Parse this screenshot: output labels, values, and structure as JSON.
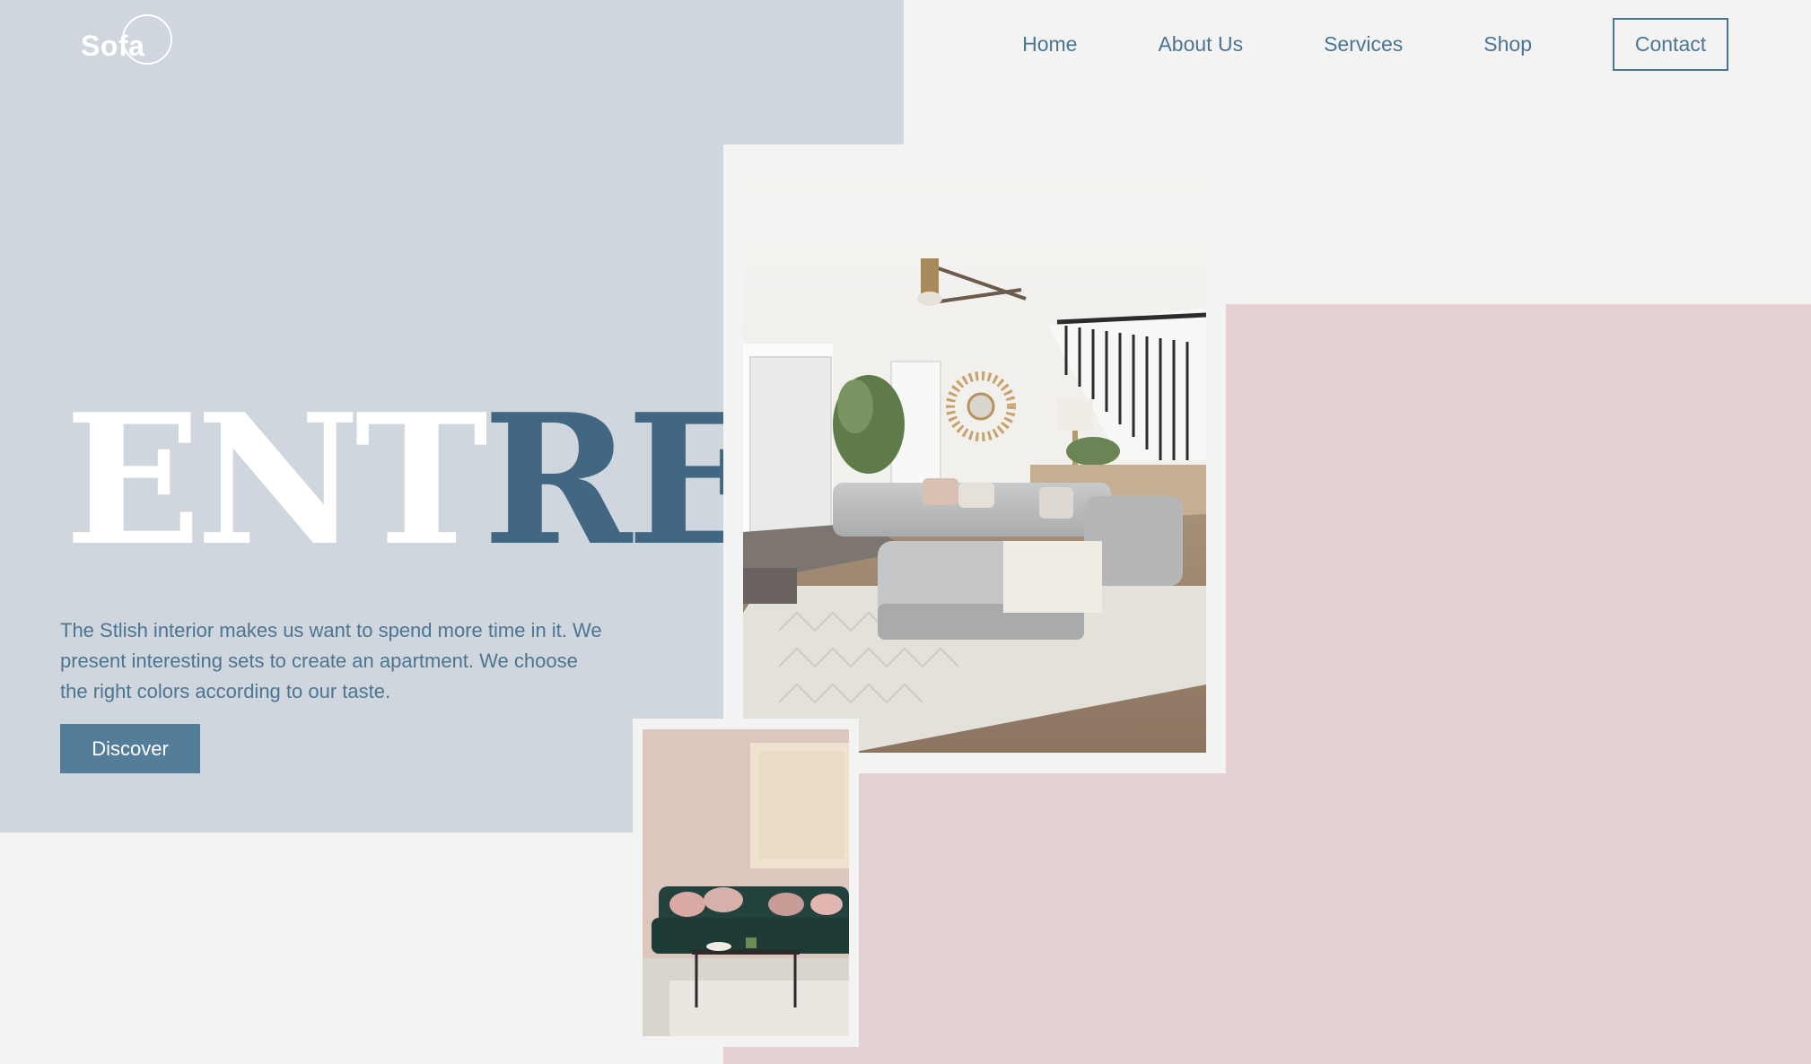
{
  "brand": {
    "logo_text": "Sofa"
  },
  "nav": {
    "items": [
      "Home",
      "About Us",
      "Services",
      "Shop"
    ],
    "contact_label": "Contact"
  },
  "hero": {
    "title_light": "ENT",
    "title_dark": "RE",
    "description": "The Stlish interior makes us want to spend more time in it. We present interesting sets to create an apartment. We choose the right colors according to our taste.",
    "cta_label": "Discover"
  },
  "colors": {
    "accent": "#4b7592",
    "hero_block": "#d0d6dd",
    "pink_block": "#e5d0d4",
    "background": "#f3f3f3",
    "button": "#547d9a"
  },
  "images": {
    "main": "living-room-sectional-sofa-photo",
    "secondary": "green-velvet-sofa-photo"
  }
}
